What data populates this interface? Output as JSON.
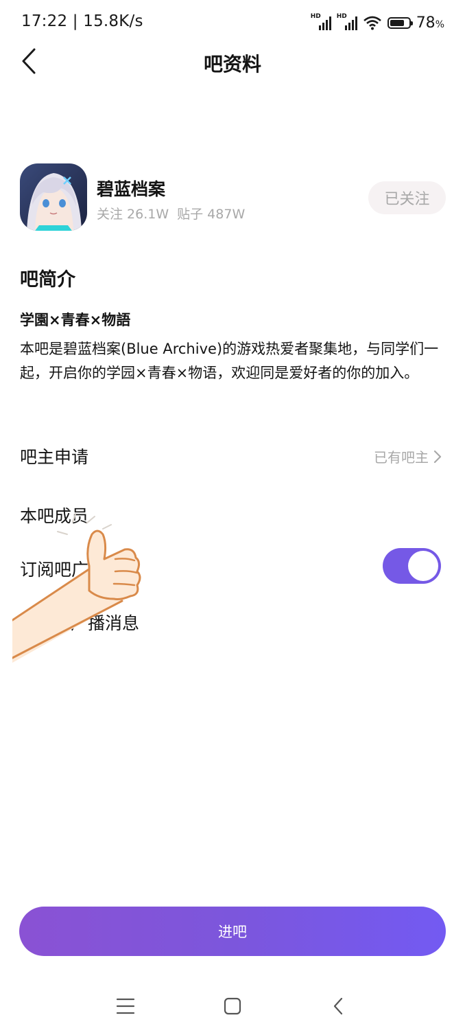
{
  "status_bar": {
    "time_speed": "17:22 | 15.8K/s",
    "signal_1_label": "HD",
    "signal_2_label": "HD",
    "battery_percent": "78",
    "battery_unit": "%",
    "battery_level": 0.78
  },
  "header": {
    "title": "吧资料"
  },
  "forum": {
    "name": "碧蓝档案",
    "followers": "关注 26.1W",
    "posts": "贴子 487W",
    "follow_button": "已关注"
  },
  "intro": {
    "section_title": "吧简介",
    "subtitle": "学園×青春×物語",
    "body": "本吧是碧蓝档案(Blue Archive)的游戏热爱者聚集地，与同学们一起，开启你的学园×青春×物语，欢迎同是爱好者的你的加入。"
  },
  "rows": {
    "admin_apply_label": "吧主申请",
    "admin_apply_status": "已有吧主",
    "members_label": "本吧成员",
    "subscribe_label": "订阅吧广",
    "subscribe_on": true,
    "broadcast_label": "吧广播消息"
  },
  "enter_button": "进吧",
  "colors": {
    "accent": "#7559e6",
    "button_gradient_start": "#8a52d4",
    "button_gradient_end": "#735af2",
    "muted_text": "#a8a8a8",
    "follow_bg": "#f6f2f3"
  },
  "icons": {
    "back": "chevron-left-icon",
    "row_arrow": "chevron-right-icon",
    "sticker": "thumbs-up-sticker",
    "nav_menu": "menu-icon",
    "nav_home": "square-home-icon",
    "nav_back": "back-triangle-icon"
  }
}
